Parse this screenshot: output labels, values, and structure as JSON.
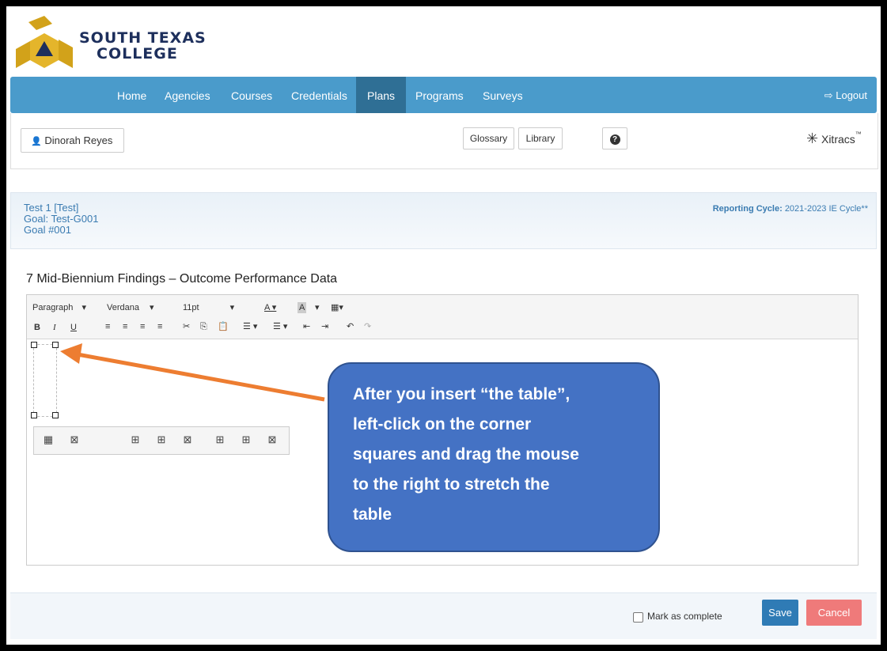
{
  "logo": {
    "line1": "SOUTH TEXAS",
    "line2": "COLLEGE"
  },
  "nav": {
    "items": [
      "Home",
      "Agencies",
      "Courses",
      "Credentials",
      "Plans",
      "Programs",
      "Surveys"
    ],
    "active": "Plans",
    "logout": "Logout"
  },
  "userbar": {
    "user": "Dinorah Reyes",
    "glossary": "Glossary",
    "library": "Library",
    "brand": "Xitracs"
  },
  "plan": {
    "line1": "Test 1 [Test]",
    "line2": "Goal: Test-G001",
    "line3": "Goal #001",
    "cycle_label": "Reporting Cycle:",
    "cycle_value": "2021-2023 IE Cycle**"
  },
  "section_title": "7 Mid-Biennium Findings – Outcome Performance Data",
  "toolbar": {
    "block": "Paragraph",
    "font": "Verdana",
    "size": "11pt"
  },
  "callout": {
    "lines": [
      "After you insert “the table”,",
      "left-click on the corner",
      "squares and drag the mouse",
      "to the right to stretch the",
      "table"
    ]
  },
  "footer": {
    "mark_complete": "Mark as complete",
    "save": "Save",
    "cancel": "Cancel"
  },
  "colors": {
    "nav": "#4a9bcb",
    "nav_active": "#2f6f95",
    "callout": "#4472c4",
    "arrow": "#ed7d31",
    "save": "#2f7bb5",
    "cancel": "#ef7a7a"
  }
}
